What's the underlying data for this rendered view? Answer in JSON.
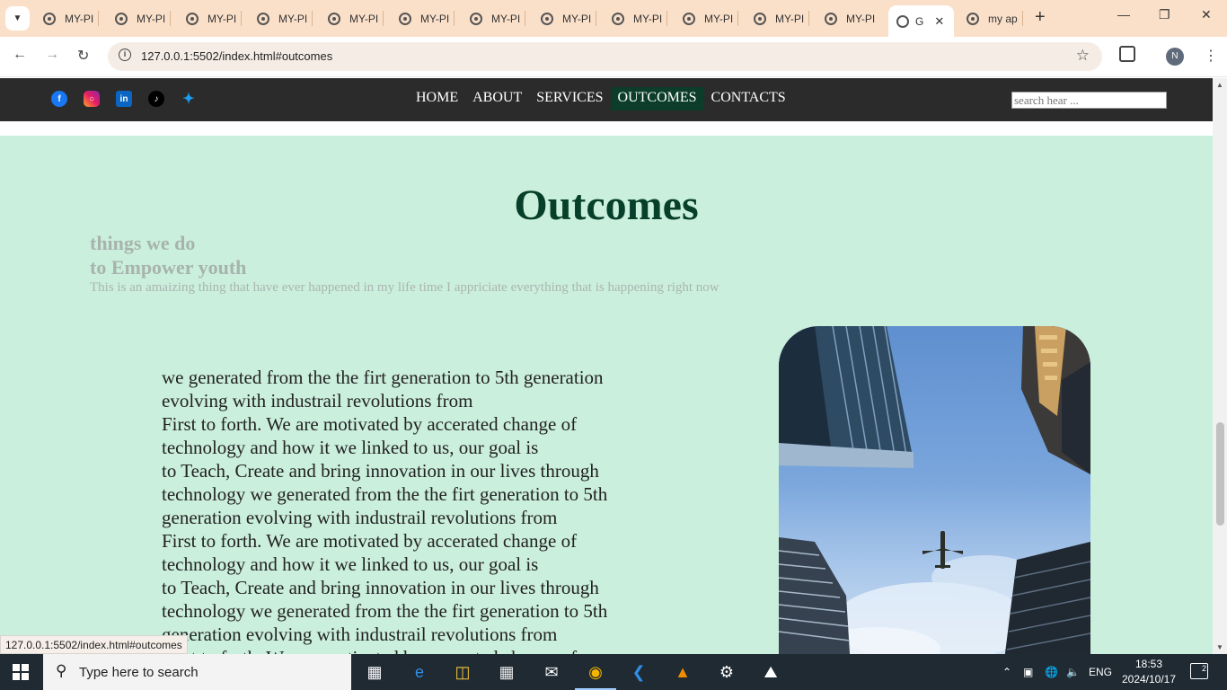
{
  "browser": {
    "tabs": [
      {
        "label": "MY-PI"
      },
      {
        "label": "MY-PI"
      },
      {
        "label": "MY-PI"
      },
      {
        "label": "MY-PI"
      },
      {
        "label": "MY-PI"
      },
      {
        "label": "MY-PI"
      },
      {
        "label": "MY-PI"
      },
      {
        "label": "MY-PI"
      },
      {
        "label": "MY-PI"
      },
      {
        "label": "MY-PI"
      },
      {
        "label": "MY-PI"
      },
      {
        "label": "MY-PI"
      }
    ],
    "active_tab": {
      "label": "G"
    },
    "last_tab": {
      "label": "my ap"
    },
    "new_tab_symbol": "+",
    "url": "127.0.0.1:5502/index.html#outcomes",
    "profile_initial": "N"
  },
  "site": {
    "social_icons": [
      "facebook-icon",
      "instagram-icon",
      "linkedin-icon",
      "tiktok-icon",
      "twitter-icon"
    ],
    "nav": {
      "items": [
        {
          "label": "HOME"
        },
        {
          "label": "ABOUT"
        },
        {
          "label": "SERVICES"
        },
        {
          "label": "OUTCOMES"
        },
        {
          "label": "CONTACTS"
        }
      ],
      "active": "OUTCOMES"
    },
    "search": {
      "placeholder": "search hear ..."
    },
    "outcomes": {
      "title": "Outcomes",
      "subtitle_line1": "things we do",
      "subtitle_line2": "to Empower youth",
      "tagline": "This is an amaizing thing that have ever happened in my life time I appriciate everything that is happening right now",
      "body_lines": [
        "we generated from the the firt generation to 5th generation",
        "evolving with industrail revolutions from",
        "First to forth. We are motivated by accerated change of",
        "technology and how it we linked to us, our goal is",
        "to Teach, Create and bring innovation in our lives through",
        "technology we generated from the the firt generation to 5th",
        "generation evolving with industrail revolutions from",
        "First to forth. We are motivated by accerated change of",
        "technology and how it we linked to us, our goal is",
        "to Teach, Create and bring innovation in our lives through",
        "technology we generated from the the firt generation to 5th",
        "generation evolving with industrail revolutions from",
        "First to forth. We are motivated by accerated change of"
      ]
    },
    "colors": {
      "section_bg": "#cbefdd",
      "title_color": "#07402a",
      "nav_bg": "#2b2b2b",
      "nav_active_bg": "#0b3d2a"
    }
  },
  "status_bar": {
    "url": "127.0.0.1:5502/index.html#outcomes"
  },
  "taskbar": {
    "search_placeholder": "Type here to search",
    "language": "ENG",
    "time": "18:53",
    "date": "2024/10/17",
    "notification_count": "2"
  }
}
